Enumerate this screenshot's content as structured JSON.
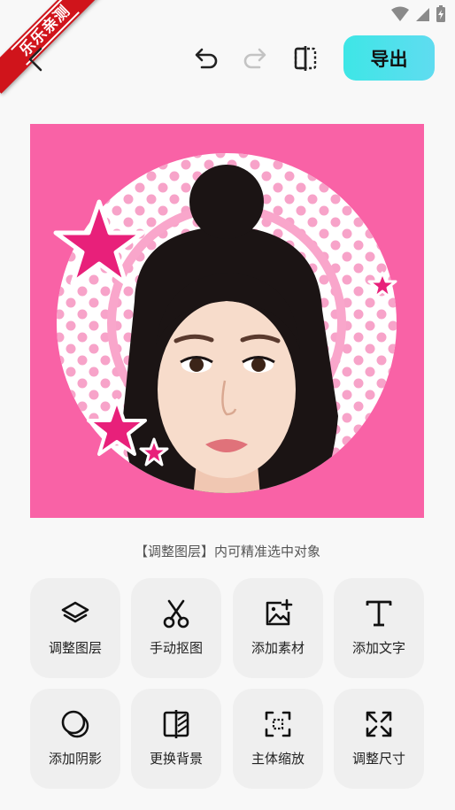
{
  "watermark": {
    "text": "乐乐亲测"
  },
  "toolbar": {
    "back": "back-icon",
    "undo": "undo-icon",
    "redo": "redo-icon",
    "compare": "compare-icon",
    "export_label": "导出"
  },
  "canvas": {
    "background_color": "#f962a6",
    "subject": "portrait photo with circular polka-dot frame and pink stars"
  },
  "hint": "【调整图层】内可精准选中对象",
  "tools": [
    {
      "label": "调整图层",
      "icon": "layers-icon"
    },
    {
      "label": "手动抠图",
      "icon": "scissors-icon"
    },
    {
      "label": "添加素材",
      "icon": "add-image-icon"
    },
    {
      "label": "添加文字",
      "icon": "text-icon"
    },
    {
      "label": "添加阴影",
      "icon": "shadow-icon"
    },
    {
      "label": "更换背景",
      "icon": "background-icon"
    },
    {
      "label": "主体缩放",
      "icon": "scale-icon"
    },
    {
      "label": "调整尺寸",
      "icon": "resize-icon"
    }
  ],
  "colors": {
    "accent": "#3ee6e6",
    "canvas": "#f962a6",
    "ribbon": "#d0141b"
  }
}
